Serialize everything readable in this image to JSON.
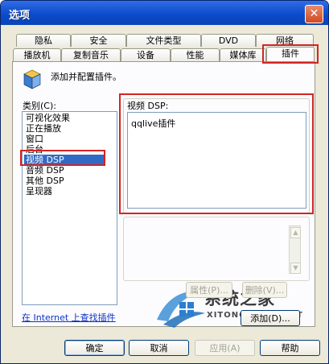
{
  "window": {
    "title": "选项",
    "close_glyph": "✕"
  },
  "tabs_row1": [
    "隐私",
    "安全",
    "文件类型",
    "DVD",
    "网络"
  ],
  "tabs_row2": [
    "播放机",
    "复制音乐",
    "设备",
    "性能",
    "媒体库",
    "插件"
  ],
  "active_tab": "插件",
  "header": {
    "description": "添加并配置插件。",
    "icon": "plugin-box-icon"
  },
  "category": {
    "label": "类别(C):",
    "items": [
      "可视化效果",
      "正在播放",
      "窗口",
      "后台",
      "视频 DSP",
      "音频 DSP",
      "其他 DSP",
      "呈现器"
    ],
    "selected": "视频 DSP"
  },
  "dsp_panel": {
    "label": "视频 DSP:",
    "items": [
      "qqlive插件"
    ]
  },
  "buttons": {
    "properties": "属性(P)...",
    "remove": "删除(V)...",
    "add": "添加(D)...",
    "ok": "确定",
    "cancel": "取消",
    "apply": "应用(A)",
    "help": "帮助"
  },
  "link": "在 Internet 上查找插件",
  "watermark": {
    "text": "系统之家",
    "subtext": "XITONGZHIJIA.NET"
  },
  "colors": {
    "titlebar": "#0a49c9",
    "selection": "#316ac5",
    "highlight": "#d42424",
    "link": "#0b32c4"
  }
}
